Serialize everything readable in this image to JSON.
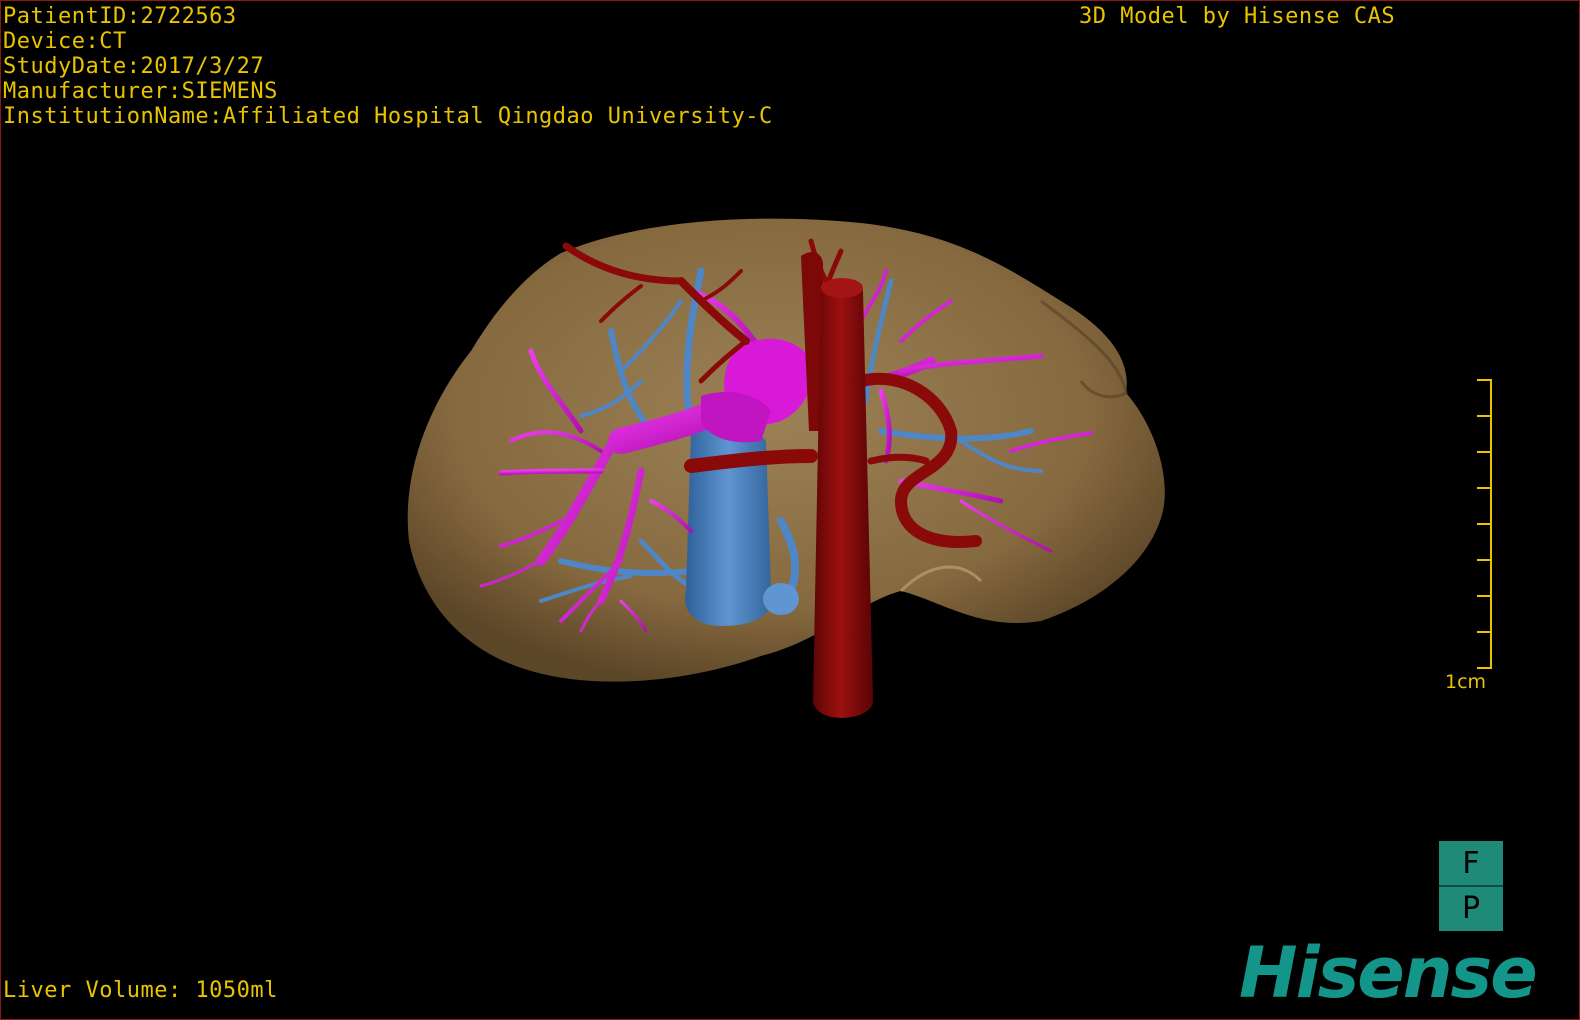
{
  "study": {
    "patient_id_line": "PatientID:2722563",
    "device_line": "Device:CT",
    "study_date_line": "StudyDate:2017/3/27",
    "manufacturer_line": "Manufacturer:SIEMENS",
    "institution_line": "InstitutionName:Affiliated Hospital Qingdao University-C"
  },
  "header": {
    "model_caption": "3D Model by Hisense CAS"
  },
  "footer": {
    "volume_line": "Liver Volume: 1050ml"
  },
  "scale": {
    "label": "1cm",
    "tick_count": 9
  },
  "orientation": {
    "top_face": "F",
    "bottom_face": "P"
  },
  "logo": {
    "text": "Hisense"
  },
  "colors": {
    "overlay_text": "#e8c400",
    "liver": "#8a7048",
    "portal_vein": "#d81ad8",
    "hepatic_vein": "#4f86c6",
    "artery": "#8a0a0a",
    "logo": "#14958a"
  },
  "model": {
    "structures": [
      "liver",
      "hepatic-vein",
      "portal-vein",
      "aorta",
      "hepatic-artery"
    ]
  }
}
